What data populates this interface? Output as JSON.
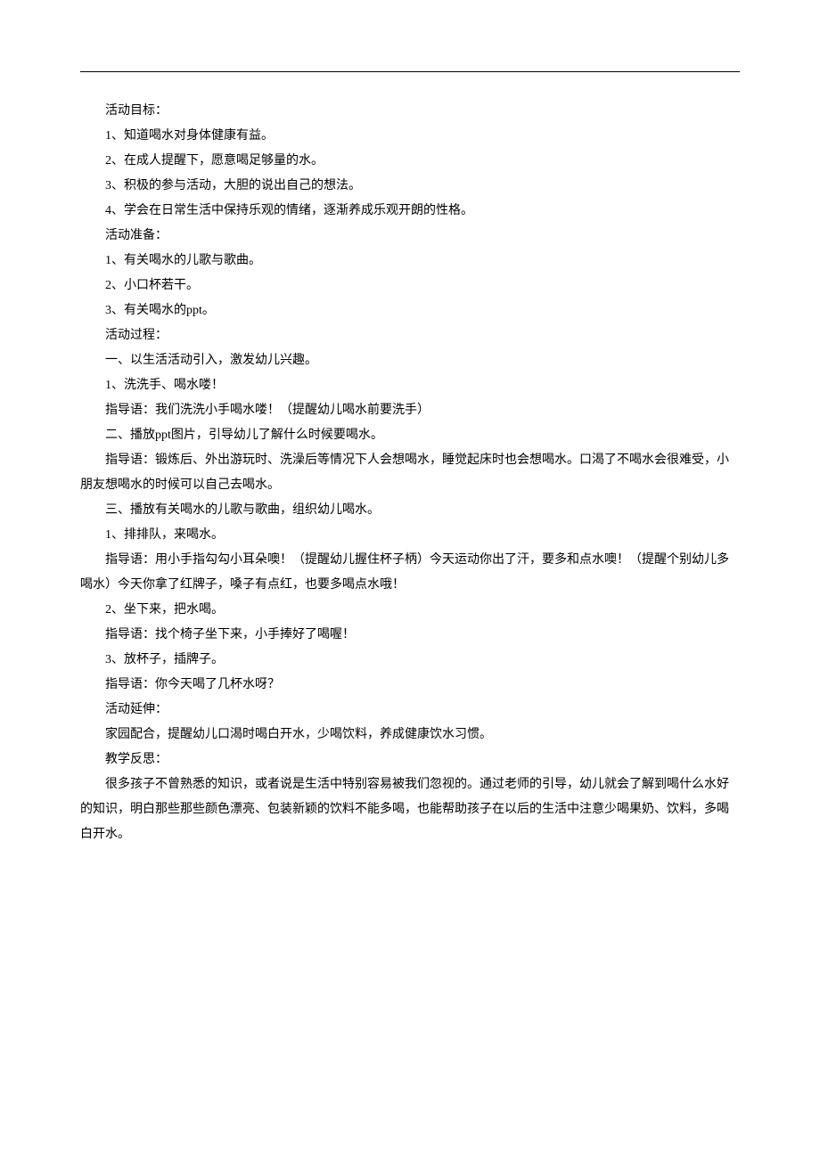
{
  "lines": [
    "活动目标：",
    "1、知道喝水对身体健康有益。",
    "2、在成人提醒下，愿意喝足够量的水。",
    "3、积极的参与活动，大胆的说出自己的想法。",
    "4、学会在日常生活中保持乐观的情绪，逐渐养成乐观开朗的性格。",
    "活动准备：",
    "1、有关喝水的儿歌与歌曲。",
    "2、小口杯若干。",
    "3、有关喝水的ppt。",
    "活动过程：",
    "一、以生活活动引入，激发幼儿兴趣。",
    "1、洗洗手、喝水喽！",
    "指导语：我们洗洗小手喝水喽！（提醒幼儿喝水前要洗手）",
    "二、播放ppt图片，引导幼儿了解什么时候要喝水。",
    "指导语：锻炼后、外出游玩时、洗澡后等情况下人会想喝水，睡觉起床时也会想喝水。口渴了不喝水会很难受，小朋友想喝水的时候可以自己去喝水。",
    "三、播放有关喝水的儿歌与歌曲，组织幼儿喝水。",
    "1、排排队，来喝水。",
    "指导语：用小手指勾勾小耳朵噢！（提醒幼儿握住杯子柄）今天运动你出了汗，要多和点水噢！（提醒个别幼儿多喝水）今天你拿了红牌子，嗓子有点红，也要多喝点水哦！",
    "2、坐下来，把水喝。",
    "指导语：找个椅子坐下来，小手捧好了喝喔！",
    "3、放杯子，插牌子。",
    "指导语：你今天喝了几杯水呀？",
    "活动延伸：",
    "家园配合，提醒幼儿口渴时喝白开水，少喝饮料，养成健康饮水习惯。",
    "教学反思：",
    "很多孩子不曾熟悉的知识，或者说是生活中特别容易被我们忽视的。通过老师的引导，幼儿就会了解到喝什么水好的知识，明白那些那些颜色漂亮、包装新颖的饮料不能多喝，也能帮助孩子在以后的生活中注意少喝果奶、饮料，多喝白开水。"
  ],
  "indentFlags": [
    true,
    true,
    true,
    true,
    true,
    true,
    true,
    true,
    true,
    true,
    true,
    true,
    true,
    true,
    true,
    true,
    true,
    true,
    true,
    true,
    true,
    true,
    true,
    true,
    true,
    true
  ],
  "multilineIndices": [
    14,
    17,
    25
  ]
}
